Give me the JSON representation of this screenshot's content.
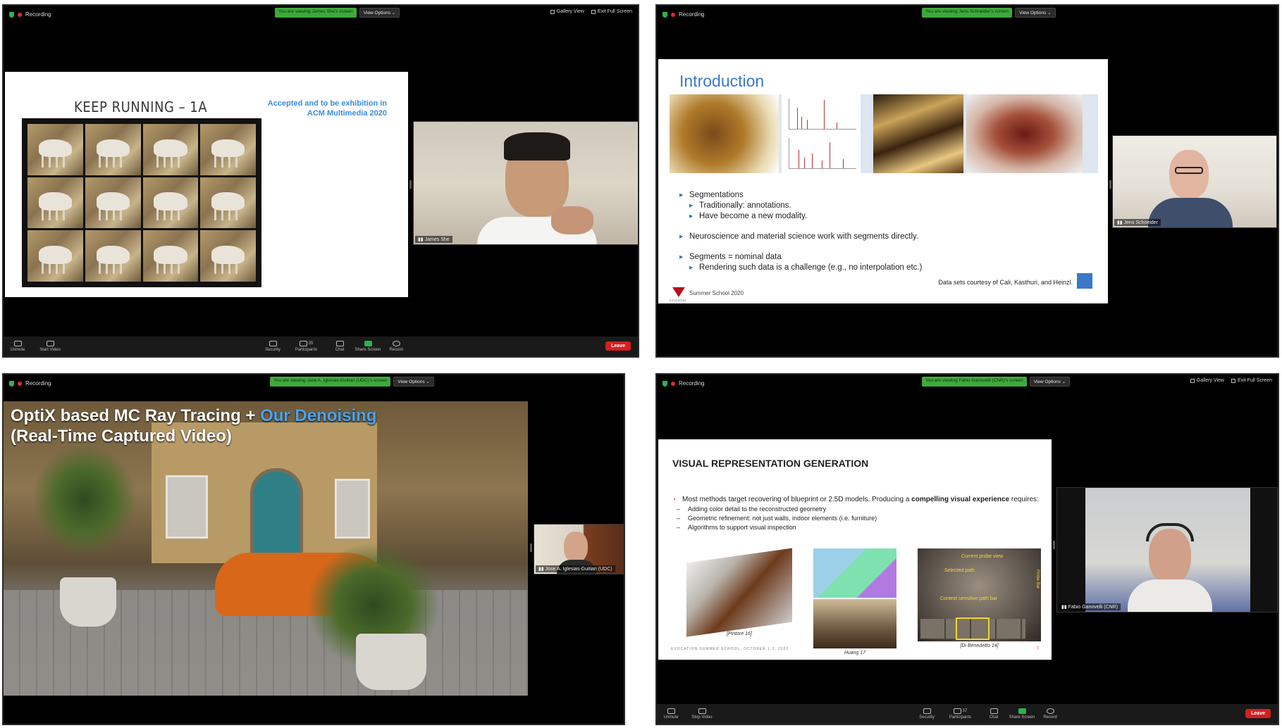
{
  "panels": [
    {
      "recording_label": "Recording",
      "viewing_banner": "You are viewing James She's screen",
      "view_options": "View Options",
      "gallery_view": "Gallery View",
      "exit_full_screen": "Exit Full Screen",
      "slide": {
        "title": "KEEP RUNNING – 1A",
        "accepted_line1": "Accepted and to be exhibition in",
        "accepted_line2": "ACM Multimedia 2020"
      },
      "camera_name": "James She",
      "toolbar": {
        "unmute": "Unmute",
        "start_video": "Start Video",
        "security": "Security",
        "participants": "Participants",
        "participants_count": "35",
        "chat": "Chat",
        "share_screen": "Share Screen",
        "record": "Record",
        "leave": "Leave"
      }
    },
    {
      "recording_label": "Recording",
      "viewing_banner": "You are viewing Jens Schneider's screen",
      "view_options": "View Options",
      "slide": {
        "title": "Introduction",
        "bullets": [
          {
            "level": 1,
            "text": "Segmentations"
          },
          {
            "level": 2,
            "text": "Traditionally: annotations."
          },
          {
            "level": 2,
            "text": "Have become a new modality."
          },
          {
            "level": 1,
            "text": "Neuroscience and material science work with segments directly."
          },
          {
            "level": 1,
            "text": "Segments = nominal data"
          },
          {
            "level": 2,
            "text": "Rendering such data is a challenge (e.g., no interpolation etc.)"
          }
        ],
        "courtesy": "Data sets courtesy of Cali, Kasthuri, and Heinzl.",
        "footer": "Summer School 2020",
        "logo_text": "EVOCATION"
      },
      "camera_name": "Jens Schneider"
    },
    {
      "recording_label": "Recording",
      "viewing_banner": "You are viewing Jose A. Iglesias-Guitian (UDC)'s screen",
      "view_options": "View Options",
      "slide": {
        "title_part1": "OptiX based MC Ray Tracing + ",
        "title_part2": "Our Denoising",
        "title_line2": "(Real-Time Captured Video)"
      },
      "camera_name": "Jose A. Iglesias-Guitian (UDC)"
    },
    {
      "recording_label": "Recording",
      "viewing_banner": "You are viewing Fabio Ganovelli (CNR)'s screen",
      "view_options": "View Options",
      "gallery_view": "Gallery View",
      "exit_full_screen": "Exit Full Screen",
      "slide": {
        "title": "VISUAL REPRESENTATION GENERATION",
        "lead_part1": "Most methods target recovering of blueprint or 2.5D models. Producing a ",
        "lead_bold": "compelling visual experience",
        "lead_part2": " requires:",
        "subs": [
          "Adding color detail to the reconstructed geometry",
          "Geometric refinement: not just walls, indoor elements (i.e. furniture)",
          "Algorithms to support visual inspection"
        ],
        "captions": [
          "[Pintore 16]",
          "Huang 17",
          "[Di Benedetto 14]"
        ],
        "overlay_current": "Current probe view",
        "overlay_selected": "Selected path",
        "overlay_context": "Context sensitive path bar",
        "overlay_probe": "Probe Bar",
        "footer": "EVOCATION SUMMER SCHOOL, OCTOBER 1-2, 2020",
        "page_number": "7"
      },
      "camera_name": "Fabio Ganovelli (CNR)",
      "toolbar": {
        "unmute": "Unmute",
        "stop_video": "Stop Video",
        "security": "Security",
        "participants": "Participants",
        "participants_count": "37",
        "chat": "Chat",
        "share_screen": "Share Screen",
        "record": "Record",
        "leave": "Leave"
      }
    }
  ],
  "colors": {
    "zoom_green": "#3eaa3b",
    "leave_red": "#d42020",
    "slide_blue": "#3a78c8",
    "accepted_blue": "#3b8de0"
  }
}
